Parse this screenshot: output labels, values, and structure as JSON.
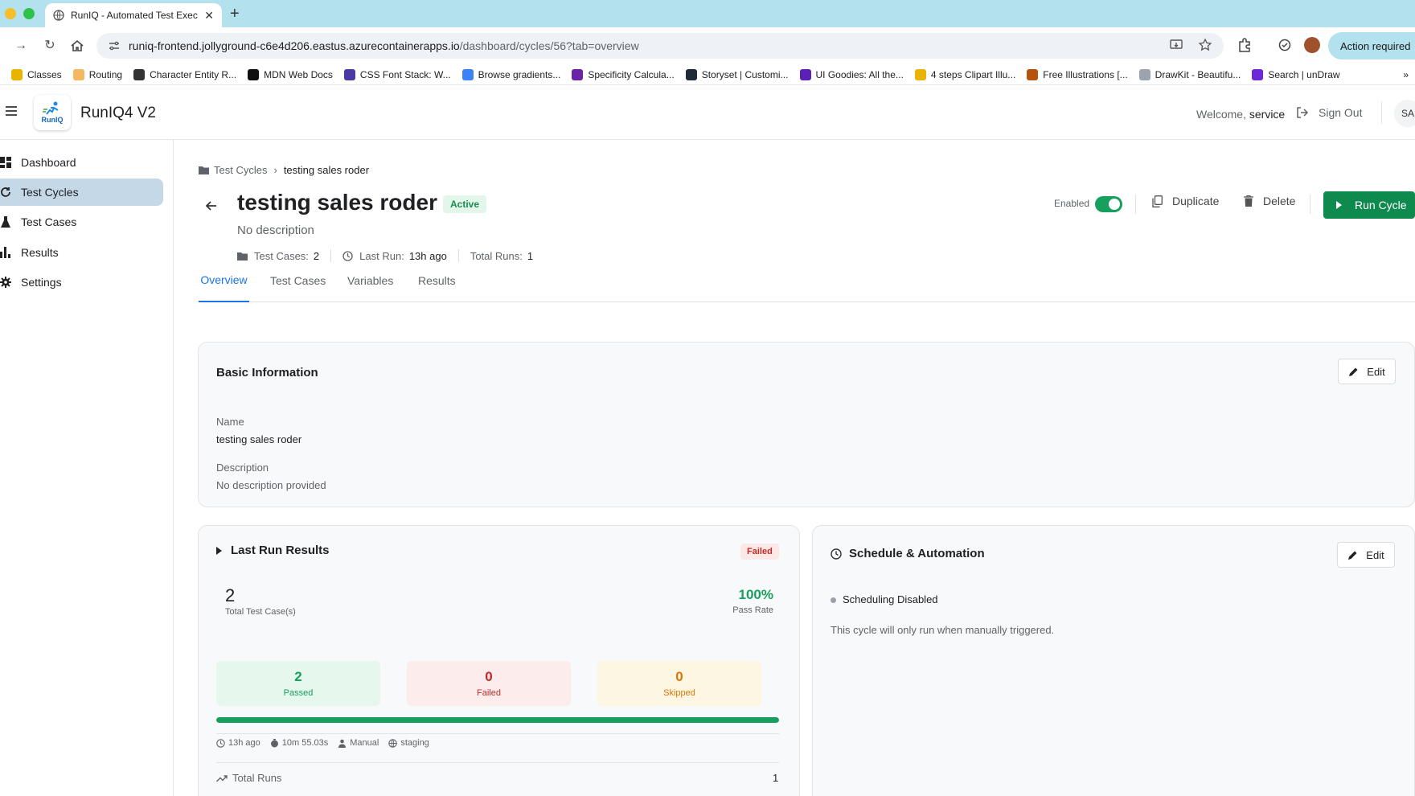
{
  "browser": {
    "tab_title": "RunIQ - Automated Test Exec",
    "url_host": "runiq-frontend.jollyground-c6e4d206.eastus.azurecontainerapps.io",
    "url_path": "/dashboard/cycles/56?tab=overview",
    "action_required": "Action required",
    "bookmarks": [
      {
        "label": "Classes",
        "color": "#e8b400"
      },
      {
        "label": "Routing",
        "color": "#f4b860"
      },
      {
        "label": "Character Entity R...",
        "color": "#333333"
      },
      {
        "label": "MDN Web Docs",
        "color": "#111111"
      },
      {
        "label": "CSS Font Stack: W...",
        "color": "#4a3aa5"
      },
      {
        "label": "Browse gradients...",
        "color": "#3b82f6"
      },
      {
        "label": "Specificity Calcula...",
        "color": "#6b21a8"
      },
      {
        "label": "Storyset | Customi...",
        "color": "#1f2937"
      },
      {
        "label": "UI Goodies: All the...",
        "color": "#5b21b6"
      },
      {
        "label": "4 steps Clipart Illu...",
        "color": "#eab308"
      },
      {
        "label": "Free Illustrations [...",
        "color": "#b45309"
      },
      {
        "label": "DrawKit - Beautifu...",
        "color": "#9ca3af"
      },
      {
        "label": "Search | unDraw",
        "color": "#6d28d9"
      }
    ]
  },
  "header": {
    "app_title": "RunIQ4 V2",
    "logo_text": "RunIQ",
    "welcome_prefix": "Welcome,",
    "welcome_user": "service",
    "sign_out": "Sign Out",
    "avatar": "SA"
  },
  "sidebar": {
    "items": [
      {
        "label": "Dashboard",
        "icon": "dashboard-icon",
        "active": false
      },
      {
        "label": "Test Cycles",
        "icon": "refresh-icon",
        "active": true
      },
      {
        "label": "Test Cases",
        "icon": "flask-icon",
        "active": false
      },
      {
        "label": "Results",
        "icon": "bar-chart-icon",
        "active": false
      },
      {
        "label": "Settings",
        "icon": "gear-icon",
        "active": false
      }
    ]
  },
  "page": {
    "breadcrumb_root": "Test Cycles",
    "breadcrumb_current": "testing sales roder",
    "title": "testing sales roder",
    "status_badge": "Active",
    "description": "No description",
    "meta": {
      "test_cases_label": "Test Cases:",
      "test_cases_value": "2",
      "last_run_label": "Last Run:",
      "last_run_value": "13h ago",
      "total_runs_label": "Total Runs:",
      "total_runs_value": "1"
    },
    "enabled_label": "Enabled",
    "enabled": true,
    "duplicate": "Duplicate",
    "delete": "Delete",
    "run_cycle": "Run Cycle",
    "tabs": [
      "Overview",
      "Test Cases",
      "Variables",
      "Results"
    ],
    "active_tab": "Overview"
  },
  "basic_info": {
    "title": "Basic Information",
    "edit": "Edit",
    "name_label": "Name",
    "name_value": "testing sales roder",
    "description_label": "Description",
    "description_value": "No description provided"
  },
  "last_run": {
    "title": "Last Run Results",
    "status": "Failed",
    "total": "2",
    "total_label": "Total Test Case(s)",
    "pass_rate": "100%",
    "pass_rate_label": "Pass Rate",
    "passed": "2",
    "passed_label": "Passed",
    "failed": "0",
    "failed_label": "Failed",
    "skipped": "0",
    "skipped_label": "Skipped",
    "progress_fraction": 1.0,
    "when": "13h ago",
    "duration": "10m 55.03s",
    "trigger": "Manual",
    "environment": "staging",
    "total_runs_label": "Total Runs",
    "total_runs_value": "1"
  },
  "schedule": {
    "title": "Schedule & Automation",
    "edit": "Edit",
    "status": "Scheduling Disabled",
    "note": "This cycle will only run when manually triggered."
  },
  "colors": {
    "accent": "#1a73e8",
    "success": "#17a05d",
    "primary_button": "#0f8a4f",
    "danger": "#c62828",
    "warning": "#d97706"
  }
}
